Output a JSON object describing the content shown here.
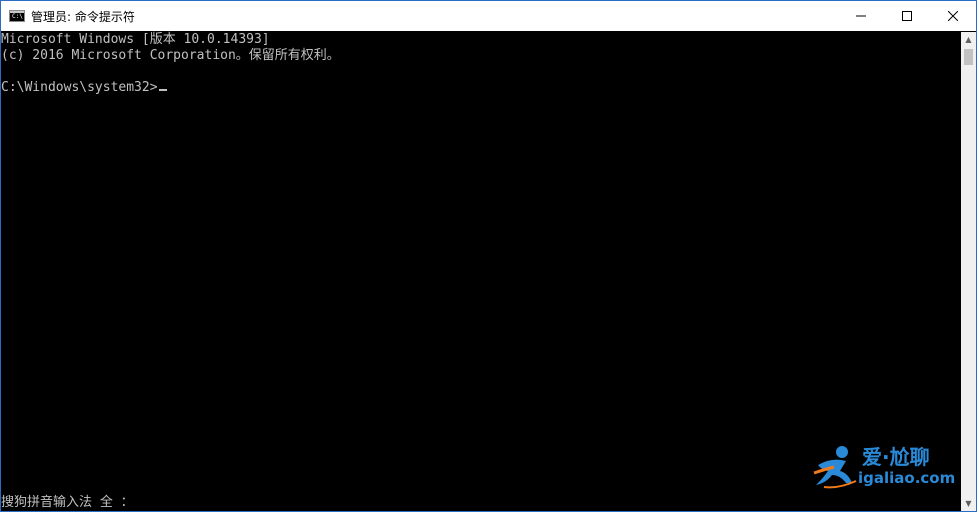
{
  "window": {
    "title": "管理员: 命令提示符",
    "icon_label": "C:\\",
    "controls": {
      "minimize_icon": "minimize-icon",
      "maximize_icon": "maximize-icon",
      "close_icon": "close-icon"
    }
  },
  "console": {
    "lines": [
      "Microsoft Windows [版本 10.0.14393]",
      "(c) 2016 Microsoft Corporation。保留所有权利。",
      "",
      "C:\\Windows\\system32>"
    ],
    "ime_status": "搜狗拼音输入法 全 ："
  },
  "watermark": {
    "line1": "爱·尬聊",
    "line2": "igaliao.com"
  },
  "colors": {
    "console_bg": "#000000",
    "console_fg": "#c0c0c0",
    "titlebar_bg": "#ffffff",
    "border": "#2b6cc4",
    "watermark": "#2a8ad8",
    "watermark_accent": "#f07a1a"
  }
}
